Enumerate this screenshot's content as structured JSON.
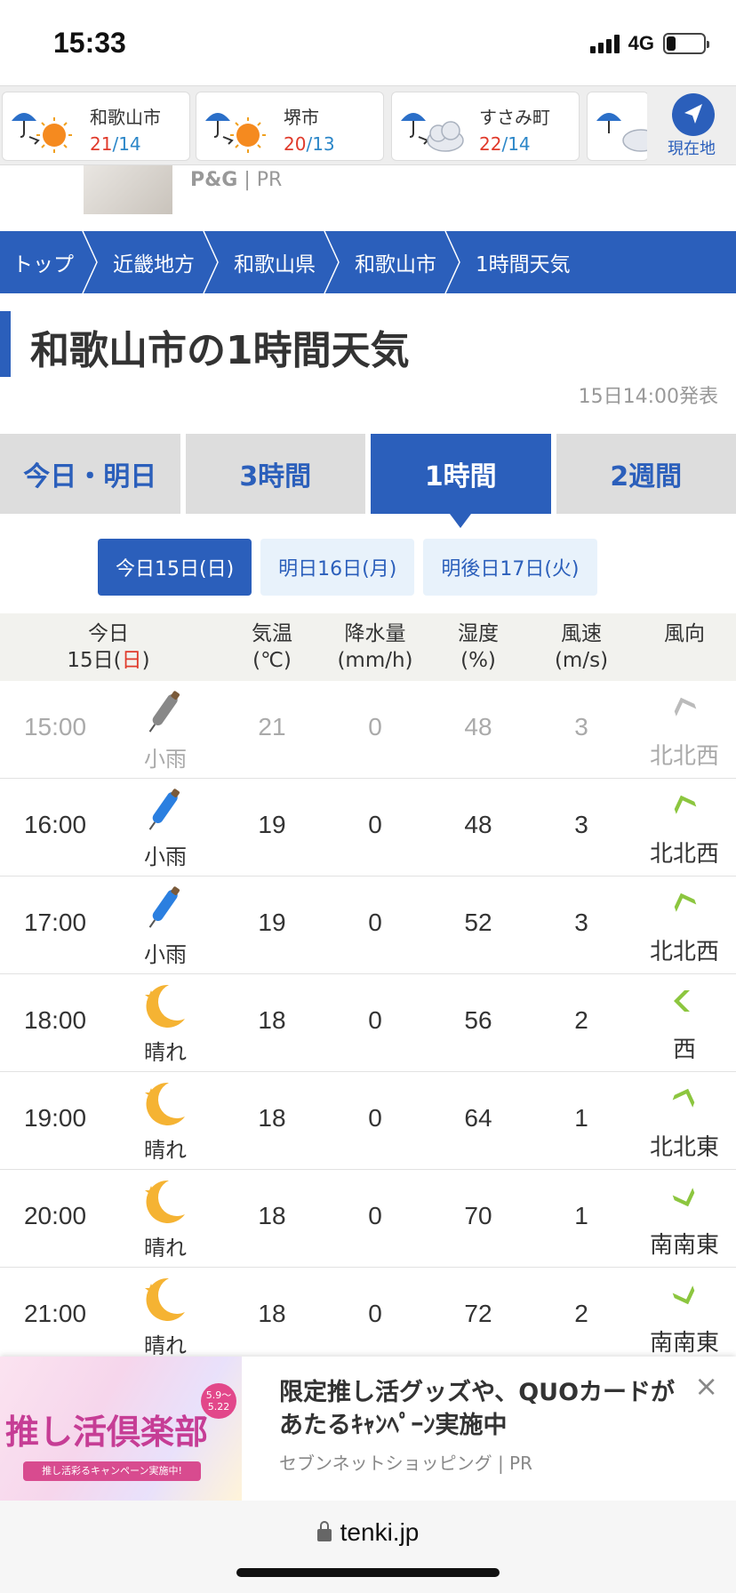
{
  "status_bar": {
    "time": "15:33",
    "network": "4G"
  },
  "locations": [
    {
      "name": "和歌山市",
      "hi": "21",
      "lo": "14",
      "icon": "rain-then-sun-icon"
    },
    {
      "name": "堺市",
      "hi": "20",
      "lo": "13",
      "icon": "rain-then-sun-icon"
    },
    {
      "name": "すさみ町",
      "hi": "22",
      "lo": "14",
      "icon": "rain-then-cloud-icon"
    }
  ],
  "temp_sep": "/",
  "current_location_label": "現在地",
  "ad_strip": {
    "sponsor": "P&G",
    "pr": "| PR"
  },
  "breadcrumb": [
    "トップ",
    "近畿地方",
    "和歌山県",
    "和歌山市",
    "1時間天気"
  ],
  "title": "和歌山市の1時間天気",
  "published": "15日14:00発表",
  "tabs": [
    "今日・明日",
    "3時間",
    "1時間",
    "2週間"
  ],
  "days": [
    "今日15日(日)",
    "明日16日(月)",
    "明後日17日(火)"
  ],
  "table_header": {
    "day_top": "今日",
    "day_bottom_prefix": "15日(",
    "day_bottom_day": "日",
    "day_bottom_suffix": ")",
    "temp": [
      "気温",
      "(℃)"
    ],
    "rain": [
      "降水量",
      "(mm/h)"
    ],
    "humidity": [
      "湿度",
      "(%)"
    ],
    "wind_speed": [
      "風速",
      "(m/s)"
    ],
    "wind_dir": [
      "風向",
      ""
    ]
  },
  "rows": [
    {
      "time": "15:00",
      "weather": "小雨",
      "icon": "umbrella-icon",
      "temp": "21",
      "rain": "0",
      "humidity": "48",
      "wind": "3",
      "dir": "北北西"
    },
    {
      "time": "16:00",
      "weather": "小雨",
      "icon": "umbrella-icon",
      "temp": "19",
      "rain": "0",
      "humidity": "48",
      "wind": "3",
      "dir": "北北西"
    },
    {
      "time": "17:00",
      "weather": "小雨",
      "icon": "umbrella-icon",
      "temp": "19",
      "rain": "0",
      "humidity": "52",
      "wind": "3",
      "dir": "北北西"
    },
    {
      "time": "18:00",
      "weather": "晴れ",
      "icon": "moon-icon",
      "temp": "18",
      "rain": "0",
      "humidity": "56",
      "wind": "2",
      "dir": "西"
    },
    {
      "time": "19:00",
      "weather": "晴れ",
      "icon": "moon-icon",
      "temp": "18",
      "rain": "0",
      "humidity": "64",
      "wind": "1",
      "dir": "北北東"
    },
    {
      "time": "20:00",
      "weather": "晴れ",
      "icon": "moon-icon",
      "temp": "18",
      "rain": "0",
      "humidity": "70",
      "wind": "1",
      "dir": "南南東"
    },
    {
      "time": "21:00",
      "weather": "晴れ",
      "icon": "moon-icon",
      "temp": "18",
      "rain": "0",
      "humidity": "72",
      "wind": "2",
      "dir": "南南東"
    }
  ],
  "bottom_ad": {
    "banner_title": "推し活倶楽部",
    "banner_date": "5.9〜5.22",
    "banner_sub": "推し活彩るキャンペーン実施中!",
    "headline": "限定推し活グッズや、QUOカードがあたるｷｬﾝﾍﾟｰﾝ実施中",
    "source": "セブンネットショッピング | PR",
    "close": "×"
  },
  "url": "tenki.jp",
  "colors": {
    "accent": "#2b5fbb",
    "hi_temp": "#e03a2b",
    "lo_temp": "#2b86c8",
    "wind_arrow": "#8cc63f"
  }
}
